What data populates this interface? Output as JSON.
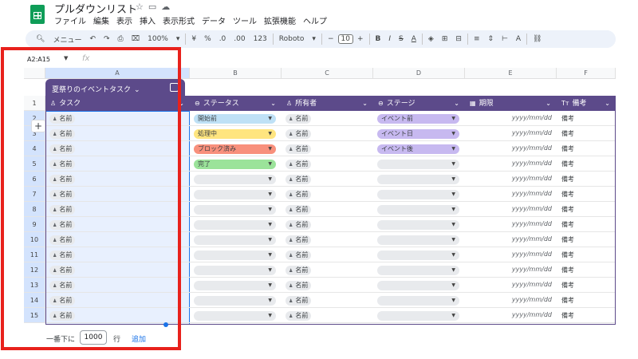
{
  "doc_title": "プルダウンリスト",
  "menu": [
    "ファイル",
    "編集",
    "表示",
    "挿入",
    "表示形式",
    "データ",
    "ツール",
    "拡張機能",
    "ヘルプ"
  ],
  "toolbar": {
    "search": "メニュー",
    "zoom": "100%",
    "currency": "¥",
    "percent": "%",
    "dec_less": ".0",
    "dec_more": ".00",
    "num_format": "123",
    "font": "Roboto",
    "font_size": "10"
  },
  "namebox": "A2:A15",
  "fx": "fx",
  "columns": [
    "A",
    "B",
    "C",
    "D",
    "E",
    "F"
  ],
  "table_name": "夏祭りのイベントタスク",
  "headers": [
    {
      "label": "タスク",
      "icon": "person-icon"
    },
    {
      "label": "ステータス",
      "icon": "dropdown-icon"
    },
    {
      "label": "所有者",
      "icon": "person-icon"
    },
    {
      "label": "ステージ",
      "icon": "dropdown-icon"
    },
    {
      "label": "期限",
      "icon": "calendar-icon"
    },
    {
      "label": "備考",
      "icon": "text-icon"
    }
  ],
  "header_row_num": "1",
  "person_placeholder": "名前",
  "date_placeholder": "yyyy/mm/dd",
  "note_placeholder": "備考",
  "rows": [
    {
      "num": "2",
      "status": "開始前",
      "status_color": "#bfe1f6",
      "stage": "イベント前",
      "stage_color": "#c7b9f0"
    },
    {
      "num": "3",
      "status": "処理中",
      "status_color": "#ffe57f",
      "stage": "イベント日",
      "stage_color": "#c7b9f0"
    },
    {
      "num": "4",
      "status": "ブロック済み",
      "status_color": "#f8907c",
      "stage": "イベント後",
      "stage_color": "#c7b9f0"
    },
    {
      "num": "5",
      "status": "完了",
      "status_color": "#9be39a",
      "stage": "",
      "stage_color": "#e8eaed"
    },
    {
      "num": "6",
      "status": "",
      "status_color": "#e8eaed",
      "stage": "",
      "stage_color": "#e8eaed"
    },
    {
      "num": "7",
      "status": "",
      "status_color": "#e8eaed",
      "stage": "",
      "stage_color": "#e8eaed"
    },
    {
      "num": "8",
      "status": "",
      "status_color": "#e8eaed",
      "stage": "",
      "stage_color": "#e8eaed"
    },
    {
      "num": "9",
      "status": "",
      "status_color": "#e8eaed",
      "stage": "",
      "stage_color": "#e8eaed"
    },
    {
      "num": "10",
      "status": "",
      "status_color": "#e8eaed",
      "stage": "",
      "stage_color": "#e8eaed"
    },
    {
      "num": "11",
      "status": "",
      "status_color": "#e8eaed",
      "stage": "",
      "stage_color": "#e8eaed"
    },
    {
      "num": "12",
      "status": "",
      "status_color": "#e8eaed",
      "stage": "",
      "stage_color": "#e8eaed"
    },
    {
      "num": "13",
      "status": "",
      "status_color": "#e8eaed",
      "stage": "",
      "stage_color": "#e8eaed"
    },
    {
      "num": "14",
      "status": "",
      "status_color": "#e8eaed",
      "stage": "",
      "stage_color": "#e8eaed"
    },
    {
      "num": "15",
      "status": "",
      "status_color": "#e8eaed",
      "stage": "",
      "stage_color": "#e8eaed"
    }
  ],
  "footer": {
    "prefix": "一番下に",
    "count": "1000",
    "unit": "行",
    "add": "追加"
  },
  "colors": {
    "table_header": "#5c4a8a",
    "selection": "#1a73e8",
    "highlight_box": "#e8211c"
  }
}
